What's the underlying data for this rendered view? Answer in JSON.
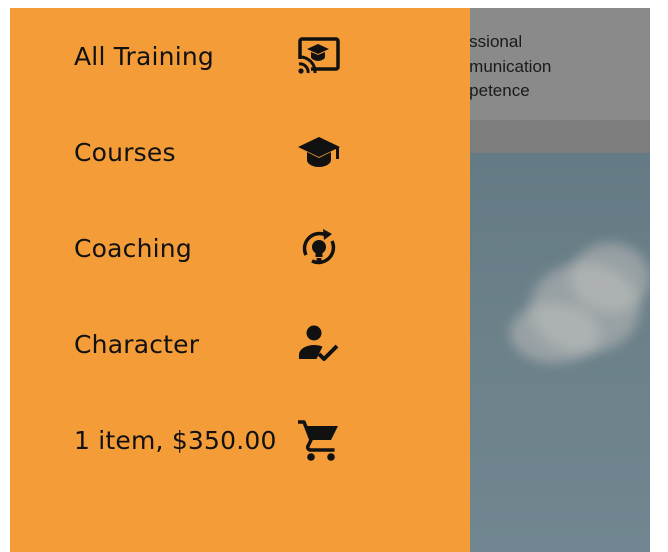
{
  "background": {
    "title_fragment": "fessional\nmmunication\nmpetence"
  },
  "menu": {
    "items": [
      {
        "label": "All Training",
        "icon": "cast-for-education-icon"
      },
      {
        "label": "Courses",
        "icon": "graduation-cap-icon"
      },
      {
        "label": "Coaching",
        "icon": "lightbulb-refresh-icon"
      },
      {
        "label": "Character",
        "icon": "person-check-icon"
      },
      {
        "label": "1 item, $350.00",
        "icon": "shopping-cart-icon"
      }
    ]
  },
  "colors": {
    "drawer": "#f39c38",
    "text": "#111111",
    "icon": "#111111"
  }
}
